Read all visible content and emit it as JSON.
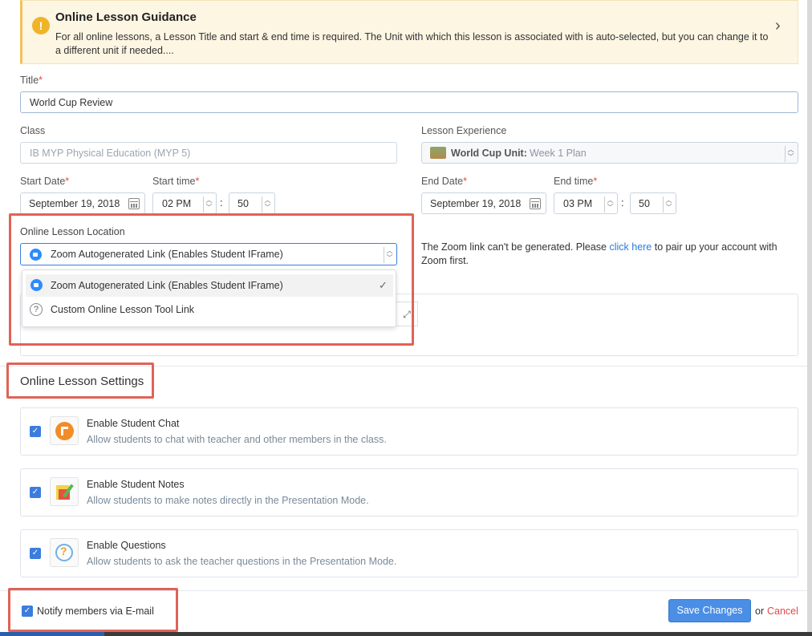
{
  "banner": {
    "title": "Online Lesson Guidance",
    "text": "For all online lessons, a Lesson Title and start & end time is required. The Unit with which this lesson is associated with is auto-selected, but you can change it to a different unit if needed....",
    "icon": "warning-icon"
  },
  "title_field": {
    "label": "Title",
    "required": "*",
    "value": "World Cup Review"
  },
  "class_field": {
    "label": "Class",
    "placeholder": "IB MYP Physical Education (MYP 5)"
  },
  "experience_field": {
    "label": "Lesson Experience",
    "unit": "World Cup Unit:",
    "plan": "Week 1 Plan"
  },
  "start": {
    "date_label": "Start Date",
    "time_label": "Start time",
    "date": "September 19, 2018",
    "hour": "02 PM",
    "minute": "50"
  },
  "end": {
    "date_label": "End Date",
    "time_label": "End time",
    "date": "September 19, 2018",
    "hour": "03 PM",
    "minute": "50"
  },
  "time_sep": ":",
  "location": {
    "label": "Online Lesson Location",
    "selected": "Zoom Autogenerated Link (Enables Student IFrame)",
    "options": [
      {
        "label": "Zoom Autogenerated Link (Enables Student IFrame)",
        "check": "✓"
      },
      {
        "label": "Custom Online Lesson Tool Link"
      }
    ],
    "zoom_note_pre": "The Zoom link can't be generated. Please ",
    "zoom_note_link": "click here",
    "zoom_note_post": " to pair up your account with Zoom first."
  },
  "settings": {
    "heading": "Online Lesson Settings",
    "items": [
      {
        "title": "Enable Student Chat",
        "desc": "Allow students to chat with teacher and other members in the class.",
        "icon": "chat-icon"
      },
      {
        "title": "Enable Student Notes",
        "desc": "Allow students to make notes directly in the Presentation Mode.",
        "icon": "notes-icon"
      },
      {
        "title": "Enable Questions",
        "desc": "Allow students to ask the teacher questions in the Presentation Mode.",
        "icon": "question-icon"
      }
    ]
  },
  "footer": {
    "notify": "Notify members via E-mail",
    "save": "Save Changes",
    "or": "or",
    "cancel": "Cancel"
  },
  "colors": {
    "accent": "#4a8ee6",
    "highlight": "#e06356",
    "warning": "#f0b429",
    "cancel": "#e04a4a"
  }
}
